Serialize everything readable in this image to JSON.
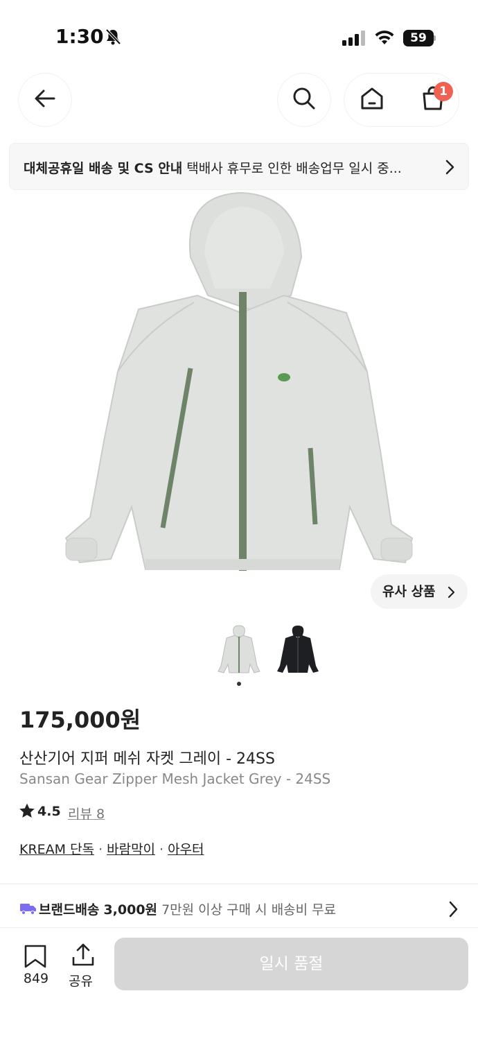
{
  "status_bar": {
    "time": "1:30",
    "battery": "59"
  },
  "nav": {
    "cart_count": "1"
  },
  "notice": {
    "title": "대체공휴일 배송 및 CS 안내",
    "body": "택배사 휴무로 인한 배송업무 일시 중..."
  },
  "similar_button": "유사 상품",
  "product": {
    "price": "175,000원",
    "name_ko": "산산기어 지퍼 메쉬 자켓 그레이 - 24SS",
    "name_en": "Sansan Gear Zipper Mesh Jacket Grey - 24SS",
    "rating": "4.5",
    "review_label": "리뷰 8",
    "tags": [
      "KREAM 단독",
      "바람막이",
      "아우터"
    ]
  },
  "shipping": {
    "label": "브랜드배송",
    "fee": "3,000원",
    "note": "7만원 이상 구매 시 배송비 무료"
  },
  "bottom_bar": {
    "bookmark_count": "849",
    "share_label": "공유",
    "buy_button": "일시 품절"
  },
  "colors": {
    "badge": "#ef6253",
    "truck": "#7b6cf0",
    "disabled_button": "#d6d6d6"
  }
}
